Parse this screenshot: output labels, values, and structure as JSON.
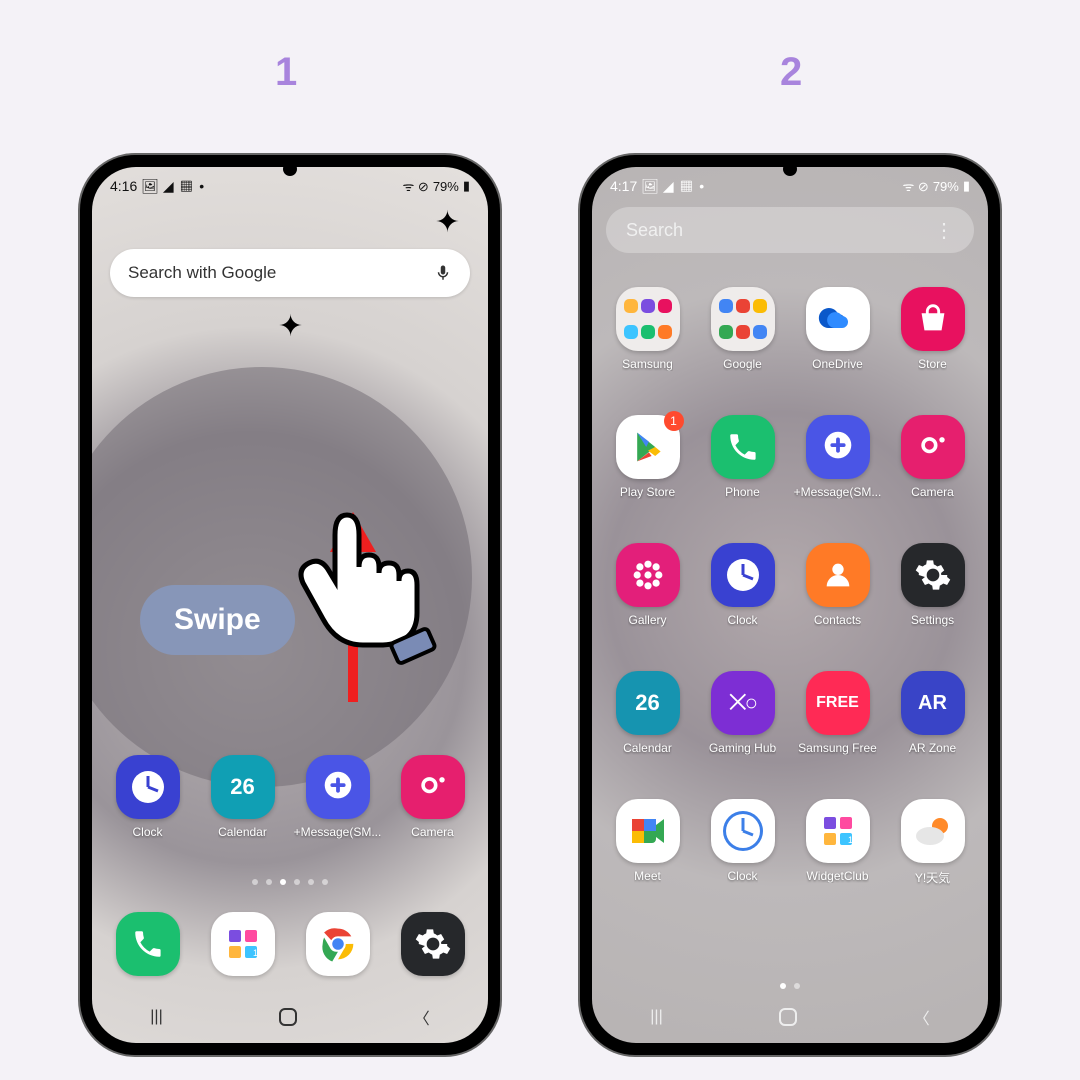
{
  "steps": {
    "one": "1",
    "two": "2"
  },
  "statusbar1": {
    "time": "4:16",
    "battery": "79%"
  },
  "statusbar2": {
    "time": "4:17",
    "battery": "79%"
  },
  "home": {
    "search_placeholder": "Search with Google",
    "swipe_label": "Swipe",
    "dock": [
      {
        "label": "Clock"
      },
      {
        "label": "Calendar",
        "day": "26"
      },
      {
        "label": "+Message(SM...",
        "short": "+Message(SM..."
      },
      {
        "label": "Camera"
      }
    ]
  },
  "drawer": {
    "search_placeholder": "Search",
    "rows": [
      [
        {
          "label": "Samsung"
        },
        {
          "label": "Google"
        },
        {
          "label": "OneDrive"
        },
        {
          "label": "Store"
        }
      ],
      [
        {
          "label": "Play Store",
          "badge": "1"
        },
        {
          "label": "Phone"
        },
        {
          "label": "+Message(SM..."
        },
        {
          "label": "Camera"
        }
      ],
      [
        {
          "label": "Gallery"
        },
        {
          "label": "Clock"
        },
        {
          "label": "Contacts"
        },
        {
          "label": "Settings"
        }
      ],
      [
        {
          "label": "Calendar",
          "day": "26"
        },
        {
          "label": "Gaming Hub"
        },
        {
          "label": "Samsung Free",
          "text": "FREE"
        },
        {
          "label": "AR Zone",
          "text": "AR"
        }
      ],
      [
        {
          "label": "Meet"
        },
        {
          "label": "Clock"
        },
        {
          "label": "WidgetClub"
        },
        {
          "label": "Y!天気"
        }
      ]
    ]
  }
}
